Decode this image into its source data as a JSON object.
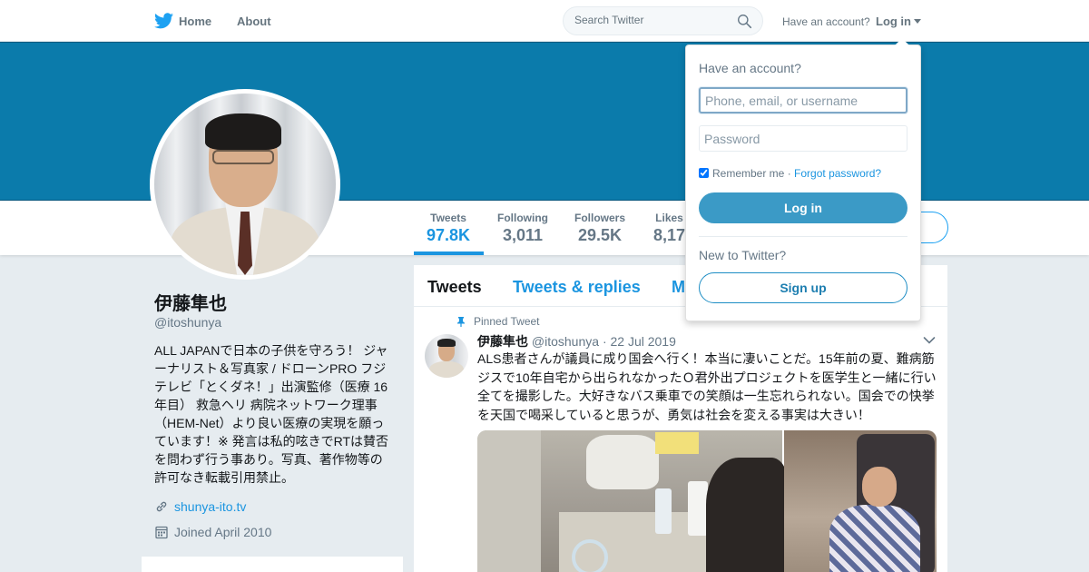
{
  "topbar": {
    "home_label": "Home",
    "about_label": "About",
    "search_placeholder": "Search Twitter",
    "have_account": "Have an account?",
    "login_label": "Log in"
  },
  "profile": {
    "name": "伊藤隼也",
    "handle": "@itoshunya",
    "bio": "ALL JAPANで日本の子供を守ろう！ ジャーナリスト＆写真家 / ドローンPRO フジテレビ「とくダネ！」出演監修（医療 16年目） 救急ヘリ 病院ネットワーク理事（HEM-Net）より良い医療の実現を願っています！※ 発言は私的呟きでRTは賛否を問わず行う事あり。写真、著作物等の許可なき転載引用禁止。",
    "website": "shunya-ito.tv",
    "joined": "Joined April 2010"
  },
  "stats": [
    {
      "label": "Tweets",
      "value": "97.8K"
    },
    {
      "label": "Following",
      "value": "3,011"
    },
    {
      "label": "Followers",
      "value": "29.5K"
    },
    {
      "label": "Likes",
      "value": "8,17"
    }
  ],
  "timeline": {
    "tabs": [
      "Tweets",
      "Tweets & replies",
      "M"
    ],
    "pinned_label": "Pinned Tweet",
    "tweet": {
      "name": "伊藤隼也",
      "handle": "@itoshunya",
      "date": "· 22 Jul 2019",
      "text": "ALS患者さんが議員に成り国会へ行く！本当に凄いことだ。15年前の夏、難病筋ジスで10年自宅から出られなかったＯ君外出プロジェクトを医学生と一緒に行い全てを撮影した。大好きなバス乗車での笑顔は一生忘れられない。国会での快挙を天国で喝采していると思うが、勇気は社会を変える事実は大きい！"
    }
  },
  "login_dropdown": {
    "title": "Have an account?",
    "username_placeholder": "Phone, email, or username",
    "password_placeholder": "Password",
    "remember_label": "Remember me",
    "separator": "·",
    "forgot_label": "Forgot password?",
    "login_button": "Log in",
    "new_label": "New to Twitter?",
    "signup_button": "Sign up"
  },
  "colors": {
    "brand_blue": "#1da1f2",
    "banner": "#0b7bab",
    "link": "#1b95e0"
  },
  "icons": [
    "twitter-bird-icon",
    "search-icon",
    "link-icon",
    "calendar-icon",
    "pin-icon",
    "chevron-down-icon"
  ]
}
